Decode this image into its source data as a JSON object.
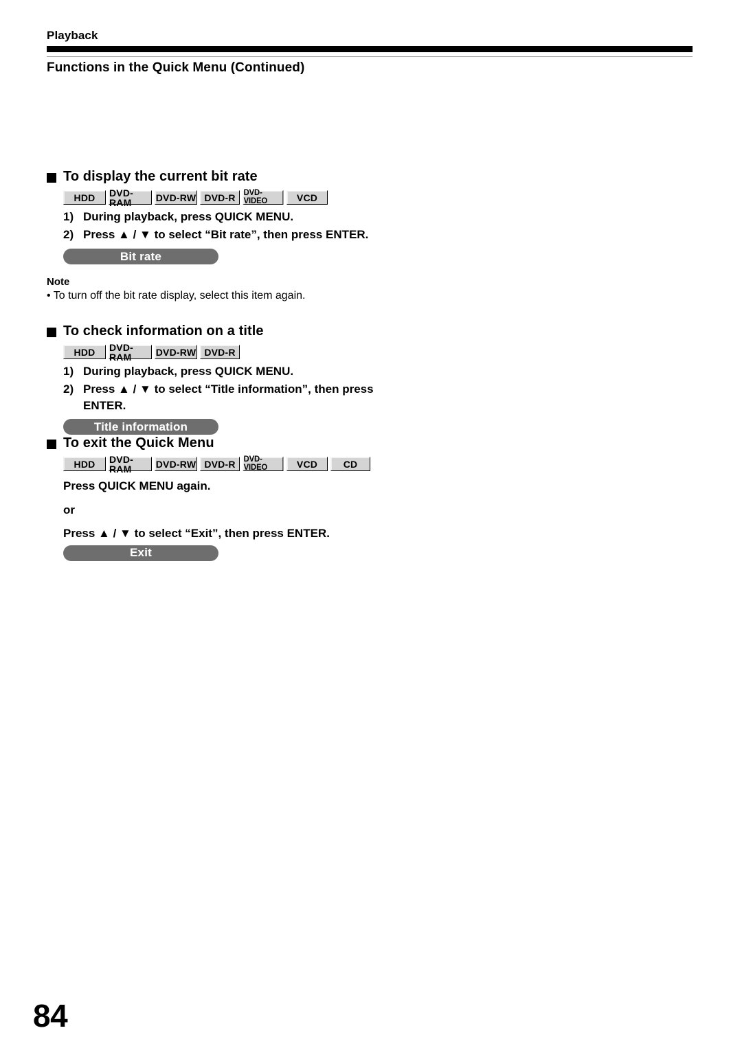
{
  "header": {
    "running_head": "Playback",
    "chapter_title": "Functions in the Quick Menu (Continued)"
  },
  "sections": [
    {
      "id": "bit-rate",
      "heading": "To display the current bit rate",
      "badges": [
        "HDD",
        "DVD-RAM",
        "DVD-RW",
        "DVD-R",
        "DVD-VIDEO",
        "VCD"
      ],
      "steps": [
        {
          "num": "1)",
          "text": "During playback, press QUICK MENU."
        },
        {
          "num": "2)",
          "text": "Press ▲ / ▼ to select “Bit rate”, then press ENTER."
        }
      ],
      "osd_item": "Bit rate",
      "note": {
        "title": "Note",
        "items": [
          "• To turn off the bit rate display, select this item again."
        ]
      }
    },
    {
      "id": "title-information",
      "heading": "To check information on a title",
      "badges": [
        "HDD",
        "DVD-RAM",
        "DVD-RW",
        "DVD-R"
      ],
      "steps": [
        {
          "num": "1)",
          "text": "During playback, press QUICK MENU."
        },
        {
          "num": "2)",
          "text": "Press ▲ / ▼ to select “Title information”, then press ENTER."
        }
      ],
      "osd_item": "Title information"
    },
    {
      "id": "exit-quick-menu",
      "heading": "To exit the Quick Menu",
      "badges": [
        "HDD",
        "DVD-RAM",
        "DVD-RW",
        "DVD-R",
        "DVD-VIDEO",
        "VCD",
        "CD"
      ],
      "lines": [
        "Press QUICK MENU again.",
        "or",
        "Press ▲ / ▼ to select “Exit”, then press ENTER."
      ],
      "osd_item": "Exit"
    }
  ],
  "footer": {
    "page_number": "84"
  },
  "colors": {
    "rule": "#000000",
    "thin_rule": "#9a9a9a",
    "badge_bg": "#d4d4d4",
    "pill_bg": "#6e6e6e",
    "pill_text": "#ffffff"
  }
}
